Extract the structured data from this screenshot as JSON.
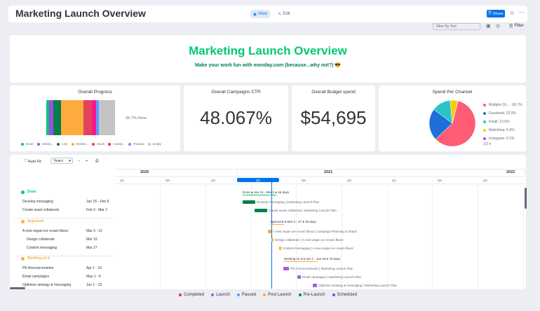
{
  "header": {
    "title": "Marketing Launch Overview",
    "view_label": "View",
    "edit_label": "Edit",
    "share_label": "Share"
  },
  "toolbar": {
    "filter_placeholder": "Filter By Text",
    "filter_label": "Filter"
  },
  "hero": {
    "title": "Marketing Launch Overview",
    "subtitle": "Make your work fun with monday.com  (because...why not?) 😎"
  },
  "widgets": {
    "progress": {
      "title": "Overall Progress",
      "done_text": "26.7% Done",
      "segments": [
        {
          "label": "Done",
          "color": "#00c875",
          "fraction": 0.04
        },
        {
          "label": "Sched...",
          "color": "#9d50dd",
          "fraction": 0.06
        },
        {
          "label": "Live",
          "color": "#037f4c",
          "fraction": 0.11
        },
        {
          "label": "Workin...",
          "color": "#fdab3d",
          "fraction": 0.33
        },
        {
          "label": "Stuck",
          "color": "#e2445c",
          "fraction": 0.12
        },
        {
          "label": "Compl...",
          "color": "#ff158a",
          "fraction": 0.06
        },
        {
          "label": "Paused",
          "color": "#579bfc",
          "fraction": 0.05
        },
        {
          "label": "empty",
          "color": "#c4c4c4",
          "fraction": 0.23
        }
      ]
    },
    "ctr": {
      "title": "Overall Campaigns CTR",
      "value": "48.067%"
    },
    "budget": {
      "title": "Overall Budget spend",
      "value": "$54,695"
    },
    "channel": {
      "title": "Spend Per Channel",
      "legend": [
        {
          "label": "Multiple Ch... : 60.7%",
          "color": "#ff5c75",
          "value": 60.7
        },
        {
          "label": "Facebook: 22.9%",
          "color": "#1e6fd9",
          "value": 22.9
        },
        {
          "label": "Email: 13.6%",
          "color": "#2ac4c6",
          "value": 13.6
        },
        {
          "label": "Mailchimp: 5.6%",
          "color": "#ffcb00",
          "value": 5.6
        },
        {
          "label": "Instagram: 0.1%",
          "color": "#9d50dd",
          "value": 0.1
        }
      ],
      "pager": "1/2"
    }
  },
  "gantt": {
    "autofit_label": "Auto Fit",
    "zoom_value": "Years",
    "years": [
      "2020",
      "2021",
      "2022"
    ],
    "quarters": [
      "Q2",
      "Q3",
      "Q4",
      "Q1",
      "Q2",
      "Q3",
      "Q4",
      "Q1",
      "Q2"
    ],
    "groups": [
      {
        "name": "Done",
        "color": "#00c875",
        "milestone": "Done ● Jan 15 - Mar 2 ● 46 days",
        "tasks": [
          {
            "name": "Develop messaging",
            "dates": "Jan 15 - Feb 9",
            "bar_label": "Develop messaging | Marketing Launch Plan",
            "color": "#037f4c"
          },
          {
            "name": "Create asset collaterals",
            "dates": "Feb 3 - Mar 2",
            "bar_label": "Create asset collaterals | Marketing Launch Plan",
            "color": "#037f4c"
          }
        ]
      },
      {
        "name": "Approved",
        "color": "#fdab3d",
        "milestone": "Approved ● Mar 3 - 27 ● 25 days",
        "tasks": [
          {
            "name": "A new vegan ice cream flavor",
            "dates": "Mar 3 - 12",
            "bar_label": "A new vegan ice cream flavor | Campaign Planning & Status",
            "color": "#fdab3d"
          },
          {
            "name": "Design collaterals",
            "dates": "Mar 10",
            "bar_label": "Design collaterals | A new vegan ice cream flavor",
            "color": "#fdab3d"
          },
          {
            "name": "Content messaging",
            "dates": "Mar 27",
            "bar_label": "Content messaging | A new vegan ice cream flavor",
            "color": "#fdab3d"
          }
        ]
      },
      {
        "name": "Working on it",
        "color": "#fdab3d",
        "milestone": "Working on it ● Apr 1 - Jun 15 ● 76 days",
        "tasks": [
          {
            "name": "PR Announcements",
            "dates": "Apr 1 - 16",
            "bar_label": "PR Announcements | Marketing Launch Plan",
            "color": "#a25ddc"
          },
          {
            "name": "Email campaigns",
            "dates": "May 1 - 6",
            "bar_label": "Email campaigns | Marketing Launch Plan",
            "color": "#a25ddc"
          },
          {
            "name": "Optimize strategy & messaging",
            "dates": "Jun 1 - 15",
            "bar_label": "Optimize strategy & messaging | Marketing Launch Plan",
            "color": "#a25ddc"
          }
        ]
      }
    ]
  },
  "bottom_legend": [
    {
      "label": "Completed",
      "color": "#ff158a"
    },
    {
      "label": "Launch",
      "color": "#a25ddc"
    },
    {
      "label": "Paused",
      "color": "#579bfc"
    },
    {
      "label": "Post Launch",
      "color": "#fdab3d"
    },
    {
      "label": "Pre-Launch",
      "color": "#037f4c"
    },
    {
      "label": "Scheduled",
      "color": "#784bd1"
    }
  ]
}
